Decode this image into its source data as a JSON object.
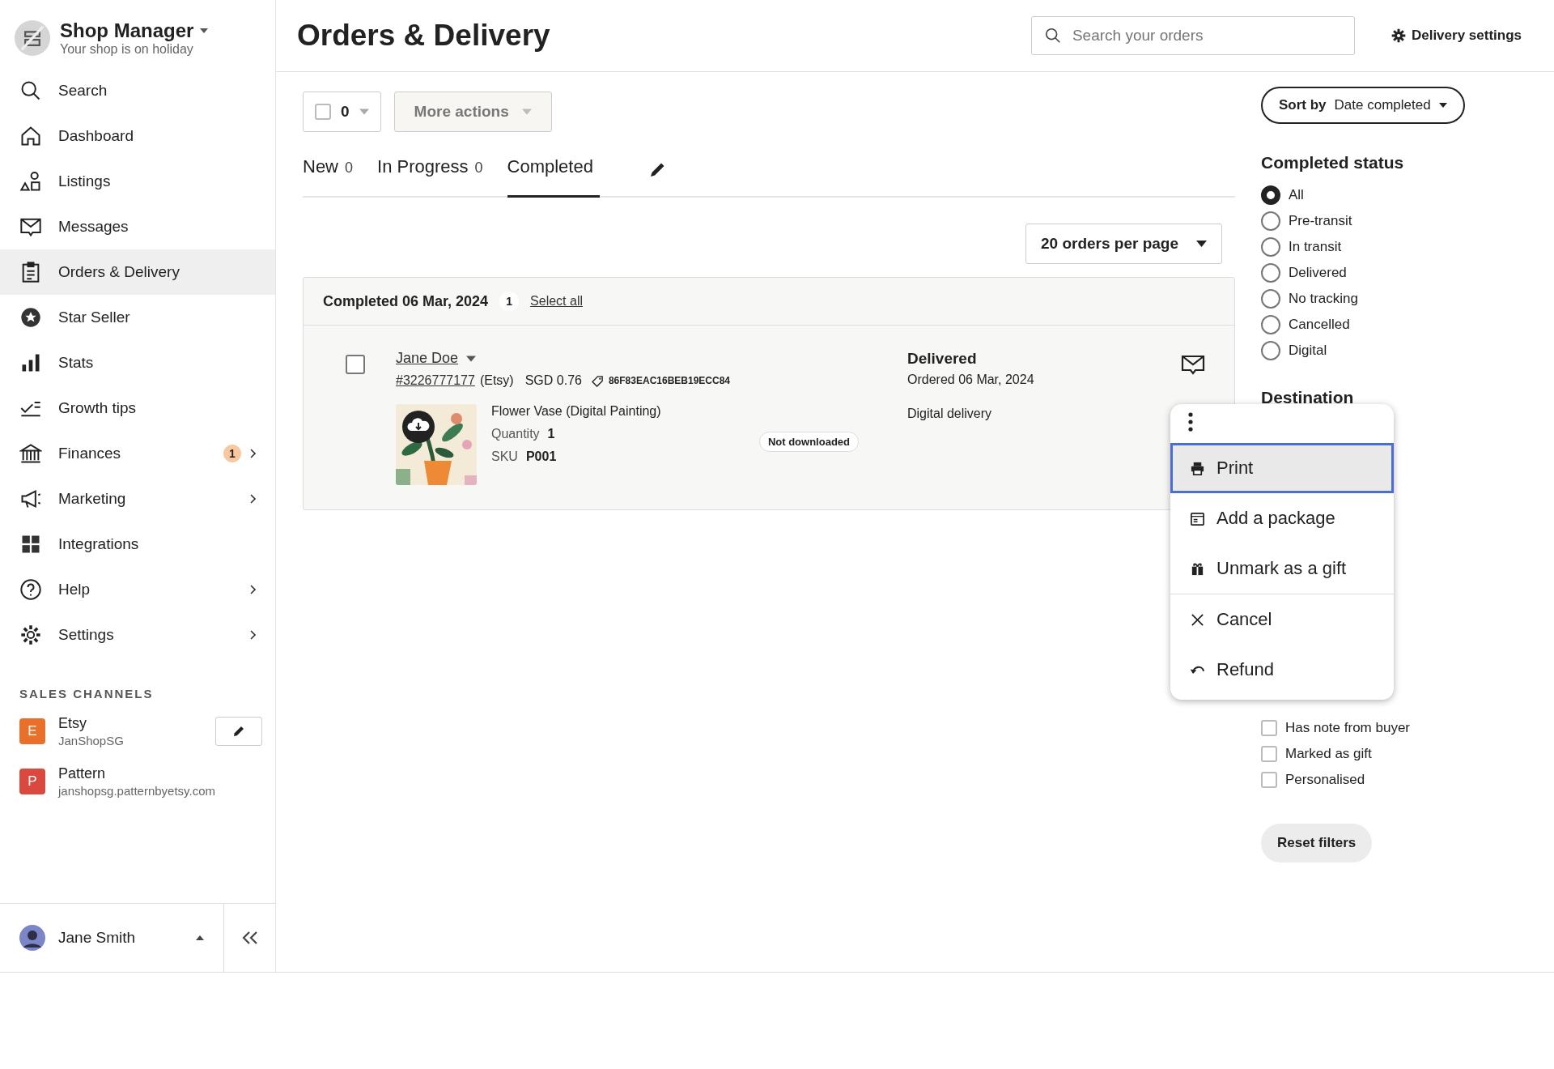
{
  "sidebar": {
    "shop": {
      "title": "Shop Manager",
      "subtitle": "Your shop is on holiday"
    },
    "items": [
      {
        "label": "Search",
        "selected": false,
        "has_submenu": false
      },
      {
        "label": "Dashboard",
        "selected": false,
        "has_submenu": false
      },
      {
        "label": "Listings",
        "selected": false,
        "has_submenu": false
      },
      {
        "label": "Messages",
        "selected": false,
        "has_submenu": false
      },
      {
        "label": "Orders & Delivery",
        "selected": true,
        "has_submenu": false
      },
      {
        "label": "Star Seller",
        "selected": false,
        "has_submenu": false
      },
      {
        "label": "Stats",
        "selected": false,
        "has_submenu": false
      },
      {
        "label": "Growth tips",
        "selected": false,
        "has_submenu": false
      },
      {
        "label": "Finances",
        "selected": false,
        "has_submenu": true,
        "badge": "1"
      },
      {
        "label": "Marketing",
        "selected": false,
        "has_submenu": true
      },
      {
        "label": "Integrations",
        "selected": false,
        "has_submenu": false
      },
      {
        "label": "Help",
        "selected": false,
        "has_submenu": true
      },
      {
        "label": "Settings",
        "selected": false,
        "has_submenu": true
      }
    ],
    "channels_heading": "SALES CHANNELS",
    "channels": [
      {
        "letter": "E",
        "name": "Etsy",
        "detail": "JanShopSG",
        "color": "#e8702a",
        "editable": true
      },
      {
        "letter": "P",
        "name": "Pattern",
        "detail": "janshopsg.patternbyetsy.com",
        "color": "#d9493f",
        "editable": false
      }
    ],
    "user": {
      "name": "Jane Smith"
    }
  },
  "header": {
    "title": "Orders & Delivery",
    "search": {
      "placeholder": "Search your orders"
    },
    "settings_button": "Delivery settings"
  },
  "toolbar": {
    "select_count": "0",
    "select_checked": false,
    "more_actions": "More actions"
  },
  "tabs": [
    {
      "label": "New",
      "count": "0",
      "selected": false
    },
    {
      "label": "In Progress",
      "count": "0",
      "selected": false
    },
    {
      "label": "Completed",
      "selected": true
    }
  ],
  "per_page": "20 orders per page",
  "group": {
    "title": "Completed 06 Mar, 2024",
    "count": "1",
    "select_all": "Select all",
    "orders": [
      {
        "checked": false,
        "buyer": "Jane Doe",
        "order_number": "#3226777177",
        "source": "(Etsy)",
        "price": "SGD 0.76",
        "code": "86F83EAC16BEB19ECC84",
        "item": "Flower Vase (Digital Painting)",
        "quantity_label": "Quantity",
        "quantity": "1",
        "sku_label": "SKU",
        "sku": "P001",
        "download_status": "Not downloaded",
        "status": "Delivered",
        "ordered": "Ordered 06 Mar, 2024",
        "delivery": "Digital delivery"
      }
    ]
  },
  "menu": {
    "groups": [
      [
        {
          "kind": "print",
          "label": "Print",
          "selected": true
        },
        {
          "kind": "package",
          "label": "Add a package",
          "selected": false
        },
        {
          "kind": "gift",
          "label": "Unmark as a gift",
          "selected": false
        }
      ],
      [
        {
          "kind": "cancel",
          "label": "Cancel",
          "selected": false
        },
        {
          "kind": "refund",
          "label": "Refund",
          "selected": false
        }
      ]
    ]
  },
  "filters": {
    "sort_label": "Sort by",
    "sort_value": "Date completed",
    "status_heading": "Completed status",
    "statuses": [
      {
        "label": "All",
        "selected": true
      },
      {
        "label": "Pre-transit",
        "selected": false
      },
      {
        "label": "In transit",
        "selected": false
      },
      {
        "label": "Delivered",
        "selected": false
      },
      {
        "label": "No tracking",
        "selected": false
      },
      {
        "label": "Cancelled",
        "selected": false
      },
      {
        "label": "Digital",
        "selected": false
      }
    ],
    "destination_heading": "Destination",
    "options": [
      {
        "label": "Has note from buyer",
        "checked": false
      },
      {
        "label": "Marked as gift",
        "checked": false
      },
      {
        "label": "Personalised",
        "checked": false
      }
    ],
    "reset": "Reset filters"
  }
}
